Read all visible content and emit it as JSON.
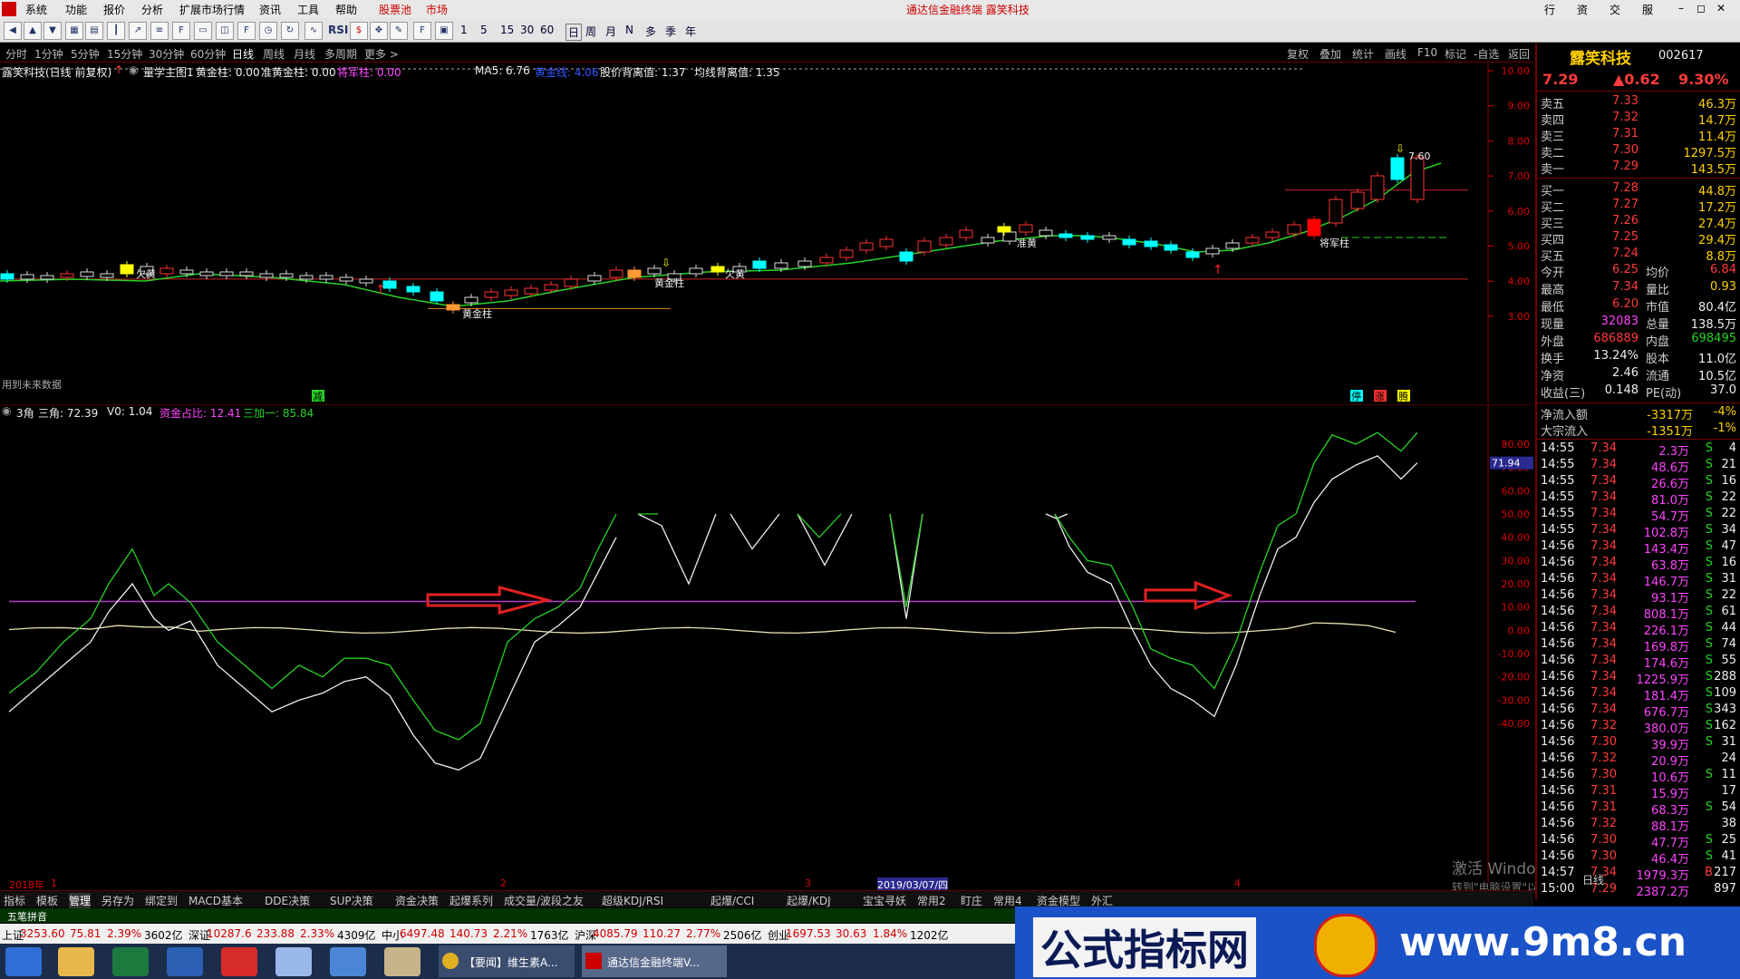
{
  "menu": {
    "items": [
      "系统",
      "功能",
      "报价",
      "分析",
      "扩展市场行情",
      "资讯",
      "工具",
      "帮助",
      "股票池",
      "市场"
    ],
    "title": "通达信金融终端 露笑科技",
    "right_buttons": [
      "行情",
      "资讯",
      "交易",
      "服务"
    ]
  },
  "toolbar": {
    "labels": [
      "RSI",
      "1",
      "5",
      "15",
      "30",
      "60",
      "日",
      "周",
      "月",
      "N",
      "多",
      "季",
      "年"
    ]
  },
  "periods": {
    "items": [
      "分时",
      "1分钟",
      "5分钟",
      "15分钟",
      "30分钟",
      "60分钟",
      "日线",
      "周线",
      "月线",
      "多周期",
      "更多 >"
    ],
    "right_items": [
      "复权",
      "叠加",
      "统计",
      "画线",
      "F10",
      "标记",
      "-自选",
      "返回"
    ]
  },
  "legend_main": {
    "title": "露笑科技(日线 前复权)",
    "formula": "量学主图1",
    "items": [
      {
        "text": "黄金柱: 0.00",
        "color": "#eeeeee"
      },
      {
        "text": "准黄金柱: 0.00",
        "color": "#eeeeee"
      },
      {
        "text": "将军柱: 0.00",
        "color": "#ff44ff"
      },
      {
        "text": "MA5: 6.76",
        "color": "#eeeeee"
      },
      {
        "text": "黄金线: 4.06",
        "color": "#3355ff"
      },
      {
        "text": "股价背离值: 1.37",
        "color": "#eeeeee"
      },
      {
        "text": "均线背离值: 1.35",
        "color": "#eeeeee"
      }
    ]
  },
  "main_axis": [
    "10.00",
    "9.00",
    "8.00",
    "7.00",
    "6.00",
    "5.00",
    "4.00",
    "3.00"
  ],
  "main_annotations": {
    "future_data": "用到未来数据",
    "labels": [
      "欠黄",
      "黄金柱",
      "黄金柱",
      "欠黄",
      "准黄",
      "将军柱"
    ],
    "high_label": "7.60",
    "bottom_marks": [
      "减",
      "停",
      "涨",
      "腾"
    ]
  },
  "legend_sub": {
    "items": [
      {
        "text": "3角",
        "color": "#eeeeee"
      },
      {
        "text": "三角: 72.39",
        "color": "#eeeeee"
      },
      {
        "text": "V0: 1.04",
        "color": "#eeeeee"
      },
      {
        "text": "资金占比: 12.41",
        "color": "#ff44ff"
      },
      {
        "text": "三加一: 85.84",
        "color": "#26d226"
      }
    ]
  },
  "sub_axis": [
    "80.00",
    "70.00",
    "60.00",
    "50.00",
    "40.00",
    "30.00",
    "20.00",
    "10.00",
    "0.00",
    "-10.00",
    "-20.00",
    "-30.00",
    "-40.00"
  ],
  "sub_current": "71.94",
  "x_axis": {
    "labels": [
      "2018年",
      "1",
      "2",
      "3",
      "2019/03/07/四",
      "4"
    ]
  },
  "watermark": {
    "line1": "激活 Windows",
    "line2": "转到\"电脑设置\"以激活 Windows。"
  },
  "stock": {
    "name": "露笑科技",
    "code": "002617",
    "price": "7.29",
    "change": "▲0.62",
    "pct": "9.30%"
  },
  "orderbook": {
    "sell": [
      {
        "label": "卖五",
        "price": "7.33",
        "vol": "46.3万"
      },
      {
        "label": "卖四",
        "price": "7.32",
        "vol": "14.7万"
      },
      {
        "label": "卖三",
        "price": "7.31",
        "vol": "11.4万"
      },
      {
        "label": "卖二",
        "price": "7.30",
        "vol": "1297.5万"
      },
      {
        "label": "卖一",
        "price": "7.29",
        "vol": "143.5万"
      }
    ],
    "buy": [
      {
        "label": "买一",
        "price": "7.28",
        "vol": "44.8万"
      },
      {
        "label": "买二",
        "price": "7.27",
        "vol": "17.2万"
      },
      {
        "label": "买三",
        "price": "7.26",
        "vol": "27.4万"
      },
      {
        "label": "买四",
        "price": "7.25",
        "vol": "29.4万"
      },
      {
        "label": "买五",
        "price": "7.24",
        "vol": "8.8万"
      }
    ]
  },
  "stats": [
    {
      "l1": "今开",
      "v1": "6.25",
      "c1": "red",
      "l2": "均价",
      "v2": "6.84",
      "c2": "red"
    },
    {
      "l1": "最高",
      "v1": "7.34",
      "c1": "red",
      "l2": "量比",
      "v2": "0.93",
      "c2": "yellow"
    },
    {
      "l1": "最低",
      "v1": "6.20",
      "c1": "red",
      "l2": "市值",
      "v2": "80.4亿",
      "c2": "white"
    },
    {
      "l1": "现量",
      "v1": "32083",
      "c1": "mag",
      "l2": "总量",
      "v2": "138.5万",
      "c2": "white"
    },
    {
      "l1": "外盘",
      "v1": "686889",
      "c1": "red",
      "l2": "内盘",
      "v2": "698495",
      "c2": "green"
    },
    {
      "l1": "换手",
      "v1": "13.24%",
      "c1": "white",
      "l2": "股本",
      "v2": "11.0亿",
      "c2": "white"
    },
    {
      "l1": "净资",
      "v1": "2.46",
      "c1": "white",
      "l2": "流通",
      "v2": "10.5亿",
      "c2": "white"
    },
    {
      "l1": "收益(三)",
      "v1": "0.148",
      "c1": "white",
      "l2": "PE(动)",
      "v2": "37.0",
      "c2": "white"
    }
  ],
  "flows": [
    {
      "label": "净流入额",
      "value": "-3317万",
      "pct": "-4%"
    },
    {
      "label": "大宗流入",
      "value": "-1351万",
      "pct": "-1%"
    }
  ],
  "ticks": [
    {
      "t": "14:55",
      "p": "7.34",
      "v": "2.3万",
      "s": "S",
      "n": "4"
    },
    {
      "t": "14:55",
      "p": "7.34",
      "v": "48.6万",
      "s": "S",
      "n": "21"
    },
    {
      "t": "14:55",
      "p": "7.34",
      "v": "26.6万",
      "s": "S",
      "n": "16"
    },
    {
      "t": "14:55",
      "p": "7.34",
      "v": "81.0万",
      "s": "S",
      "n": "22"
    },
    {
      "t": "14:55",
      "p": "7.34",
      "v": "54.7万",
      "s": "S",
      "n": "22"
    },
    {
      "t": "14:55",
      "p": "7.34",
      "v": "102.8万",
      "s": "S",
      "n": "34"
    },
    {
      "t": "14:56",
      "p": "7.34",
      "v": "143.4万",
      "s": "S",
      "n": "47"
    },
    {
      "t": "14:56",
      "p": "7.34",
      "v": "63.8万",
      "s": "S",
      "n": "16"
    },
    {
      "t": "14:56",
      "p": "7.34",
      "v": "146.7万",
      "s": "S",
      "n": "31"
    },
    {
      "t": "14:56",
      "p": "7.34",
      "v": "93.1万",
      "s": "S",
      "n": "22"
    },
    {
      "t": "14:56",
      "p": "7.34",
      "v": "808.1万",
      "s": "S",
      "n": "61"
    },
    {
      "t": "14:56",
      "p": "7.34",
      "v": "226.1万",
      "s": "S",
      "n": "44"
    },
    {
      "t": "14:56",
      "p": "7.34",
      "v": "169.8万",
      "s": "S",
      "n": "74"
    },
    {
      "t": "14:56",
      "p": "7.34",
      "v": "174.6万",
      "s": "S",
      "n": "55"
    },
    {
      "t": "14:56",
      "p": "7.34",
      "v": "1225.9万",
      "s": "S",
      "n": "288"
    },
    {
      "t": "14:56",
      "p": "7.34",
      "v": "181.4万",
      "s": "S",
      "n": "109"
    },
    {
      "t": "14:56",
      "p": "7.34",
      "v": "676.7万",
      "s": "S",
      "n": "343"
    },
    {
      "t": "14:56",
      "p": "7.32",
      "v": "380.0万",
      "s": "S",
      "n": "162"
    },
    {
      "t": "14:56",
      "p": "7.30",
      "v": "39.9万",
      "s": "S",
      "n": "31"
    },
    {
      "t": "14:56",
      "p": "7.32",
      "v": "20.9万",
      "s": "",
      "n": "24"
    },
    {
      "t": "14:56",
      "p": "7.30",
      "v": "10.6万",
      "s": "S",
      "n": "11"
    },
    {
      "t": "14:56",
      "p": "7.31",
      "v": "15.9万",
      "s": "",
      "n": "17"
    },
    {
      "t": "14:56",
      "p": "7.31",
      "v": "68.3万",
      "s": "S",
      "n": "54"
    },
    {
      "t": "14:56",
      "p": "7.32",
      "v": "88.1万",
      "s": "",
      "n": "38"
    },
    {
      "t": "14:56",
      "p": "7.30",
      "v": "47.7万",
      "s": "S",
      "n": "25"
    },
    {
      "t": "14:56",
      "p": "7.30",
      "v": "46.4万",
      "s": "S",
      "n": "41"
    },
    {
      "t": "14:57",
      "p": "7.34",
      "v": "1979.3万",
      "s": "B",
      "n": "217"
    },
    {
      "t": "15:00",
      "p": "7.29",
      "v": "2387.2万",
      "s": "",
      "n": "897"
    }
  ],
  "tick_footer": "日线",
  "bottom_tabs": [
    "指标",
    "模板",
    "管理",
    "另存为",
    "绑定到",
    "MACD基本",
    "DDE决策",
    "SUP决策",
    "资金决策",
    "起爆系列",
    "成交量/波段之友",
    "超级KDJ/RSI",
    "起爆/CCI",
    "起爆/KDJ",
    "宝宝寻妖",
    "常用2",
    "盯庄",
    "常用4",
    "资金模型",
    "外汇"
  ],
  "input_bar": "五笔拼音",
  "index_bar": [
    {
      "name": "上证",
      "val": "3253.60",
      "chg": "75.81",
      "pct": "2.39%",
      "amt": "3602亿"
    },
    {
      "name": "深证",
      "val": "10287.6",
      "chg": "233.88",
      "pct": "2.33%",
      "amt": "4309亿"
    },
    {
      "name": "中小",
      "val": "6497.48",
      "chg": "140.73",
      "pct": "2.21%",
      "amt": "1763亿"
    },
    {
      "name": "沪深",
      "val": "4085.79",
      "chg": "110.27",
      "pct": "2.77%",
      "amt": "2506亿"
    },
    {
      "name": "创业",
      "val": "1697.53",
      "chg": "30.63",
      "pct": "1.84%",
      "amt": "1202亿"
    }
  ],
  "banner": {
    "left": "公式指标网",
    "right": "www.9m8.cn"
  },
  "taskbar": {
    "items": [
      "【要闻】维生素A...",
      "通达信金融终端V..."
    ]
  }
}
